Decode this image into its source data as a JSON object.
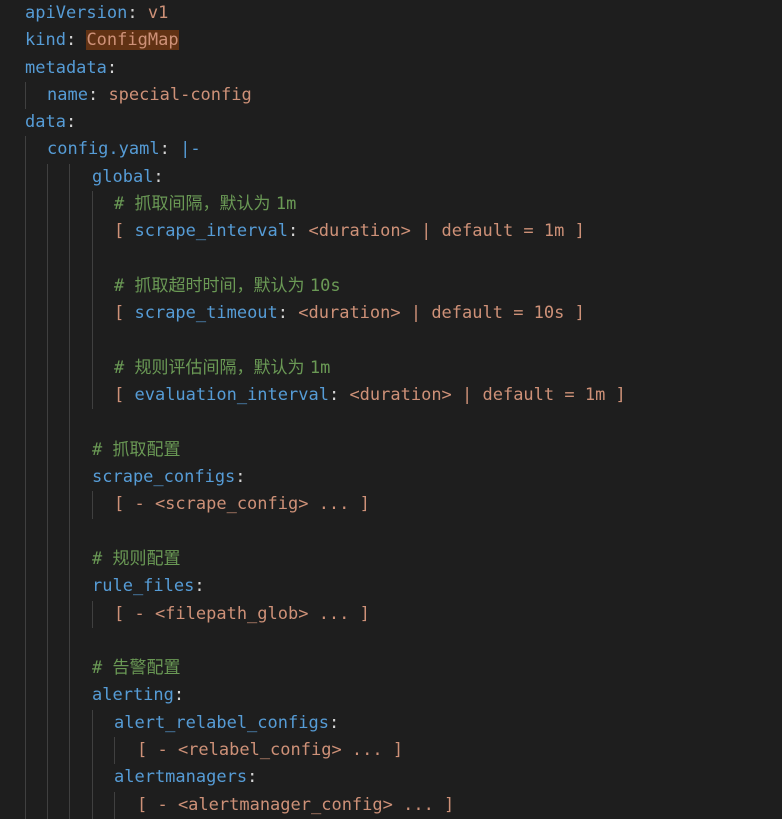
{
  "lines": [
    {
      "key": "apiVersion",
      "colon": ": ",
      "value": "v1"
    },
    {
      "key": "kind",
      "colon": ": ",
      "value": "ConfigMap"
    },
    {
      "key": "metadata",
      "colon": ":"
    },
    {
      "key": "name",
      "colon": ": ",
      "value": "special-config"
    },
    {
      "key": "data",
      "colon": ":"
    },
    {
      "key": "config.yaml",
      "colon": ": ",
      "indicator": "|-"
    },
    {
      "key": "global",
      "colon": ":"
    },
    {
      "comment_hash": "# ",
      "comment_text": "抓取间隔，默认为 ",
      "comment_num": "1m"
    },
    {
      "text_open": "[ ",
      "key": "scrape_interval",
      "colon": ": ",
      "text": "<duration> | default = 1m ]"
    },
    {
      "blank": ""
    },
    {
      "comment_hash": "# ",
      "comment_text": "抓取超时时间，默认为 ",
      "comment_num": "10s"
    },
    {
      "text_open": "[ ",
      "key": "scrape_timeout",
      "colon": ": ",
      "text": "<duration> | default = 10s ]"
    },
    {
      "blank": ""
    },
    {
      "comment_hash": "# ",
      "comment_text": "规则评估间隔，默认为 ",
      "comment_num": "1m"
    },
    {
      "text_open": "[ ",
      "key": "evaluation_interval",
      "colon": ": ",
      "text": "<duration> | default = 1m ]"
    },
    {
      "blank": ""
    },
    {
      "comment_hash": "# ",
      "comment_text": "抓取配置"
    },
    {
      "key": "scrape_configs",
      "colon": ":"
    },
    {
      "text": "[ - <scrape_config> ... ]"
    },
    {
      "blank": ""
    },
    {
      "comment_hash": "# ",
      "comment_text": "规则配置"
    },
    {
      "key": "rule_files",
      "colon": ":"
    },
    {
      "text": "[ - <filepath_glob> ... ]"
    },
    {
      "blank": ""
    },
    {
      "comment_hash": "# ",
      "comment_text": "告警配置"
    },
    {
      "key": "alerting",
      "colon": ":"
    },
    {
      "key": "alert_relabel_configs",
      "colon": ":"
    },
    {
      "text": "[ - <relabel_config> ... ]"
    },
    {
      "key": "alertmanagers",
      "colon": ":"
    },
    {
      "text": "[ - <alertmanager_config> ... ]"
    }
  ]
}
